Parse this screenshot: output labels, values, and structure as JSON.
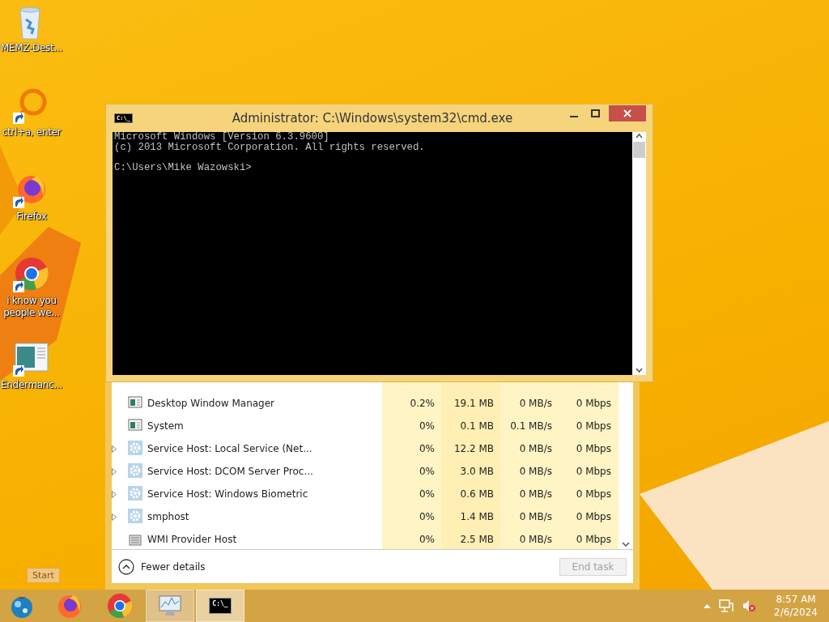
{
  "desktop_icons": [
    {
      "label": "MEMZ-Dest...",
      "kind": "recycle-bin",
      "shortcut": false
    },
    {
      "label": "ctrl+a, enter",
      "kind": "ring",
      "shortcut": true
    },
    {
      "label": "Firefox",
      "kind": "firefox",
      "shortcut": true
    },
    {
      "label": "i know you people we...",
      "kind": "chrome",
      "shortcut": true
    },
    {
      "label": "Endermanc...",
      "kind": "screenshot",
      "shortcut": true
    }
  ],
  "cmd_window": {
    "title": "Administrator: C:\\Windows\\system32\\cmd.exe",
    "icon_text": "C:\\_",
    "lines": [
      "Microsoft Windows [Version 6.3.9600]",
      "(c) 2013 Microsoft Corporation. All rights reserved."
    ],
    "prompt": "C:\\Users\\Mike Wazowski>"
  },
  "task_manager": {
    "rows": [
      {
        "name": "Desktop Window Manager",
        "kind": "window",
        "expandable": false,
        "cpu": "0.2%",
        "memory": "19.1 MB",
        "disk": "0 MB/s",
        "network": "0 Mbps"
      },
      {
        "name": "System",
        "kind": "window",
        "expandable": false,
        "cpu": "0%",
        "memory": "0.1 MB",
        "disk": "0.1 MB/s",
        "network": "0 Mbps"
      },
      {
        "name": "Service Host: Local Service (Net...",
        "kind": "gear",
        "expandable": true,
        "cpu": "0%",
        "memory": "12.2 MB",
        "disk": "0 MB/s",
        "network": "0 Mbps"
      },
      {
        "name": "Service Host: DCOM Server Proc...",
        "kind": "gear",
        "expandable": true,
        "cpu": "0%",
        "memory": "3.0 MB",
        "disk": "0 MB/s",
        "network": "0 Mbps"
      },
      {
        "name": "Service Host: Windows Biometric",
        "kind": "gear",
        "expandable": true,
        "cpu": "0%",
        "memory": "0.6 MB",
        "disk": "0 MB/s",
        "network": "0 Mbps"
      },
      {
        "name": "smphost",
        "kind": "gear",
        "expandable": true,
        "cpu": "0%",
        "memory": "1.4 MB",
        "disk": "0 MB/s",
        "network": "0 Mbps"
      },
      {
        "name": "WMI Provider Host",
        "kind": "server",
        "expandable": false,
        "cpu": "0%",
        "memory": "2.5 MB",
        "disk": "0 MB/s",
        "network": "0 Mbps"
      }
    ],
    "fewer_details": "Fewer details",
    "end_task": {
      "label": "End task",
      "disabled": true
    }
  },
  "tooltip": "Start",
  "taskbar": {
    "items": [
      {
        "kind": "start",
        "selected": false,
        "running": false
      },
      {
        "kind": "firefox",
        "selected": false,
        "running": false
      },
      {
        "kind": "chrome",
        "selected": false,
        "running": false
      },
      {
        "kind": "taskmgr",
        "selected": false,
        "running": true
      },
      {
        "kind": "cmd",
        "selected": true,
        "running": true,
        "icon_text": "C:\\_"
      }
    ],
    "time": "8:57 AM",
    "date": "2/6/2024",
    "volume_muted": true
  }
}
